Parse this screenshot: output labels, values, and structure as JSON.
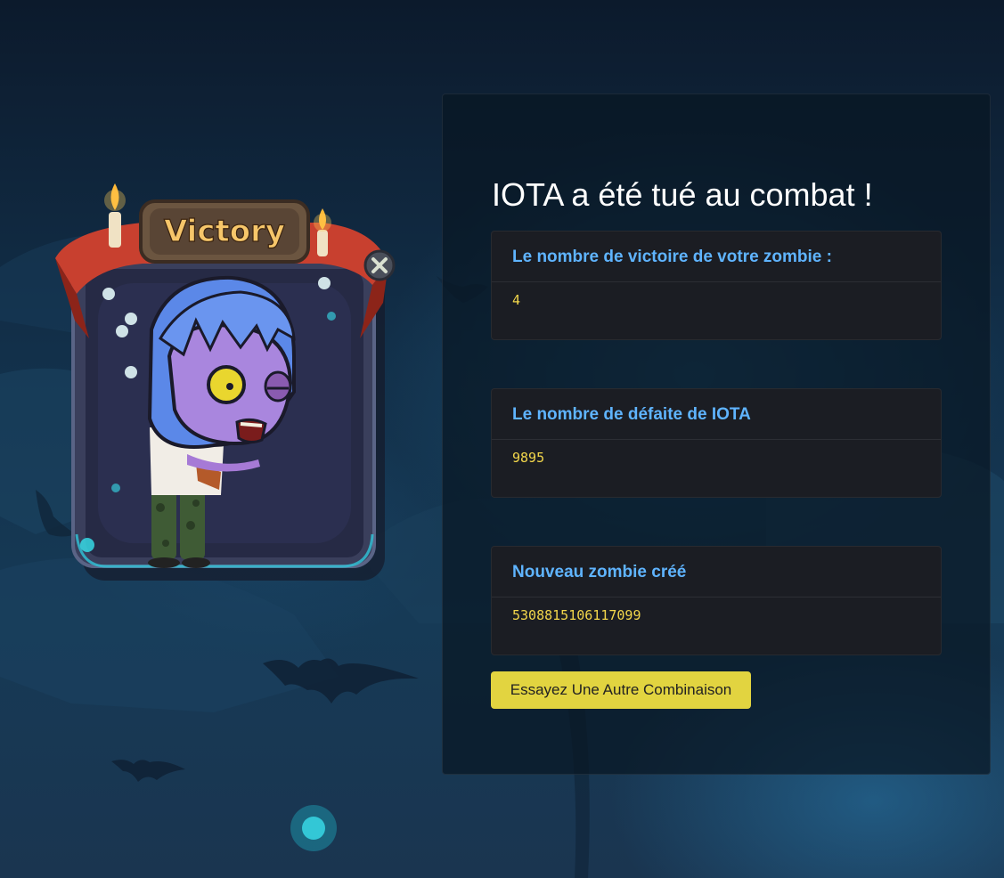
{
  "victory": {
    "banner_label": "Victory"
  },
  "result": {
    "title": "IOTA a été tué au combat !"
  },
  "cards": [
    {
      "header": "Le nombre de victoire de votre zombie :",
      "value": "4"
    },
    {
      "header": "Le nombre de défaite de IOTA",
      "value": "9895"
    },
    {
      "header": "Nouveau zombie créé",
      "value": "5308815106117099"
    }
  ],
  "actions": {
    "retry_label": "Essayez Une Autre Combinaison"
  },
  "colors": {
    "card_header": "#5fb4ff",
    "card_value": "#f2d64b",
    "button": "#e2d440",
    "banner": "#c8402f"
  },
  "icons": [
    "close-icon",
    "skull-icon",
    "candle-icon",
    "bat-icon"
  ]
}
